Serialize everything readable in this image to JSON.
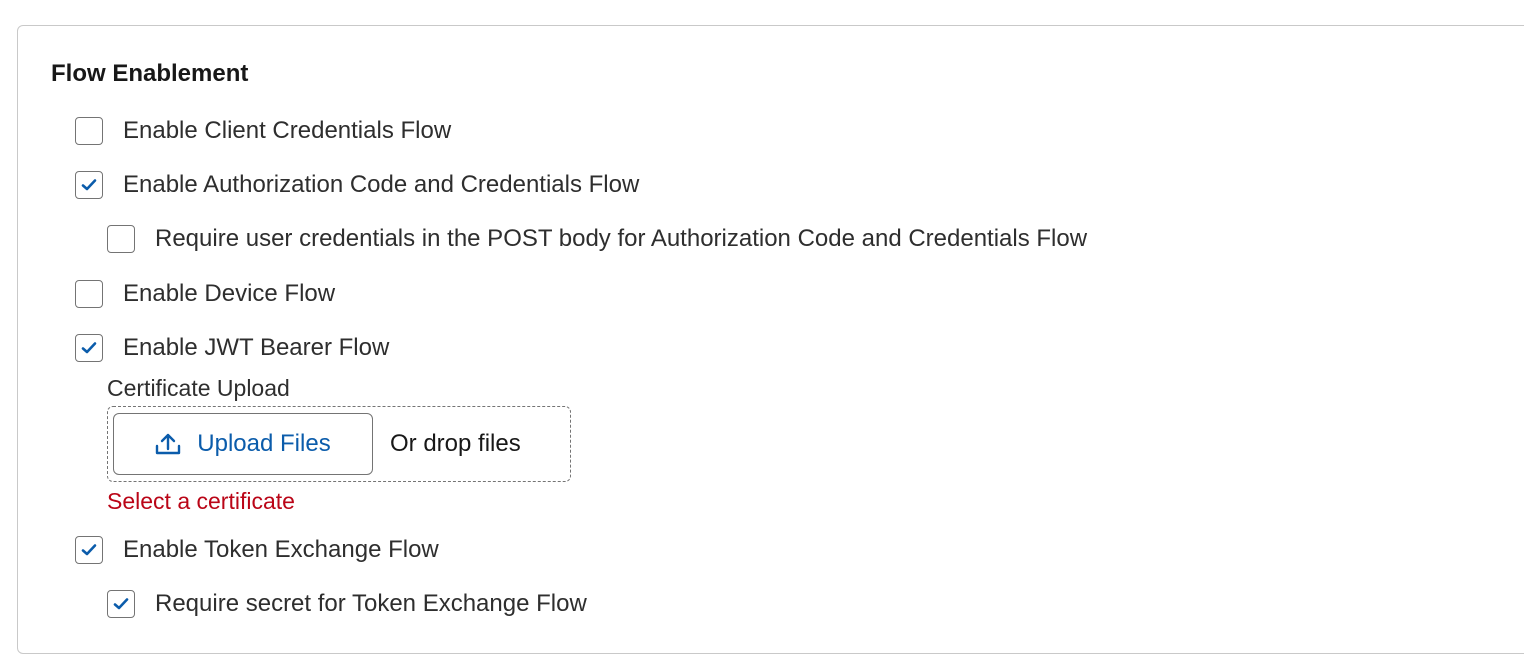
{
  "section": {
    "title": "Flow Enablement"
  },
  "flows": {
    "client_credentials": {
      "label": "Enable Client Credentials Flow",
      "checked": false
    },
    "auth_code_credentials": {
      "label": "Enable Authorization Code and Credentials Flow",
      "checked": true
    },
    "require_user_credentials": {
      "label": "Require user credentials in the POST body for Authorization Code and Credentials Flow",
      "checked": false
    },
    "device": {
      "label": "Enable Device Flow",
      "checked": false
    },
    "jwt_bearer": {
      "label": "Enable JWT Bearer Flow",
      "checked": true
    },
    "token_exchange": {
      "label": "Enable Token Exchange Flow",
      "checked": true
    },
    "require_secret_token_exchange": {
      "label": "Require secret for Token Exchange Flow",
      "checked": true
    }
  },
  "certificate_upload": {
    "label": "Certificate Upload",
    "button_label": "Upload Files",
    "drop_text": "Or drop files",
    "error": "Select a certificate",
    "upload_icon": "upload-icon"
  },
  "colors": {
    "check": "#0b5cab",
    "link": "#0b5cab",
    "error": "#ba0517",
    "border": "#747474"
  }
}
